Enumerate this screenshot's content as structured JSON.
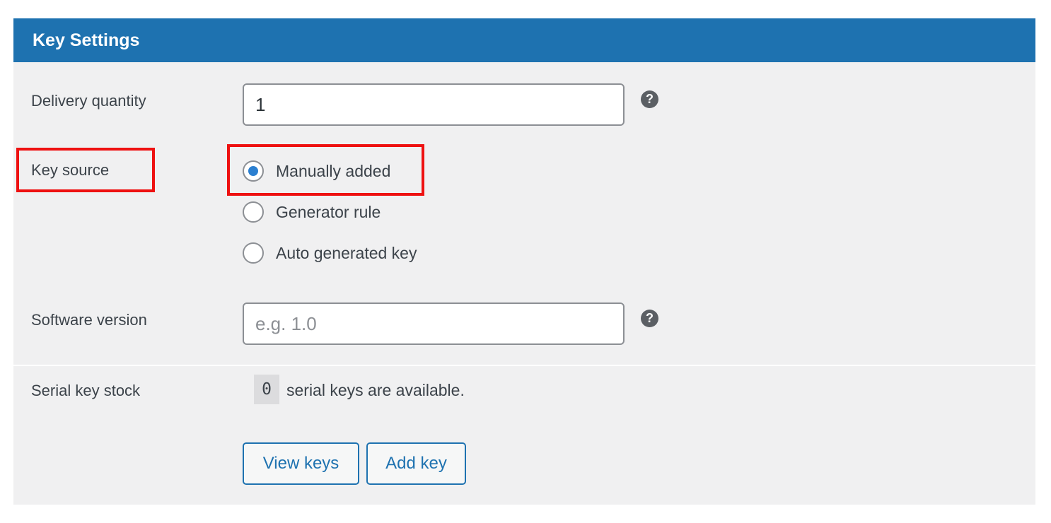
{
  "panel": {
    "title": "Key Settings"
  },
  "delivery_quantity": {
    "label": "Delivery quantity",
    "value": "1",
    "help": "?"
  },
  "key_source": {
    "label": "Key source",
    "options": [
      {
        "label": "Manually added",
        "selected": true
      },
      {
        "label": "Generator rule",
        "selected": false
      },
      {
        "label": "Auto generated key",
        "selected": false
      }
    ]
  },
  "software_version": {
    "label": "Software version",
    "placeholder": "e.g. 1.0",
    "help": "?"
  },
  "serial_key_stock": {
    "label": "Serial key stock",
    "count": "0",
    "text": "serial keys are available.",
    "view_button": "View keys",
    "add_button": "Add key"
  },
  "colors": {
    "header": "#1e72b0",
    "panel_bg": "#f0f0f1",
    "highlight": "#ee1111",
    "radio_checked": "#2b7fd0"
  }
}
